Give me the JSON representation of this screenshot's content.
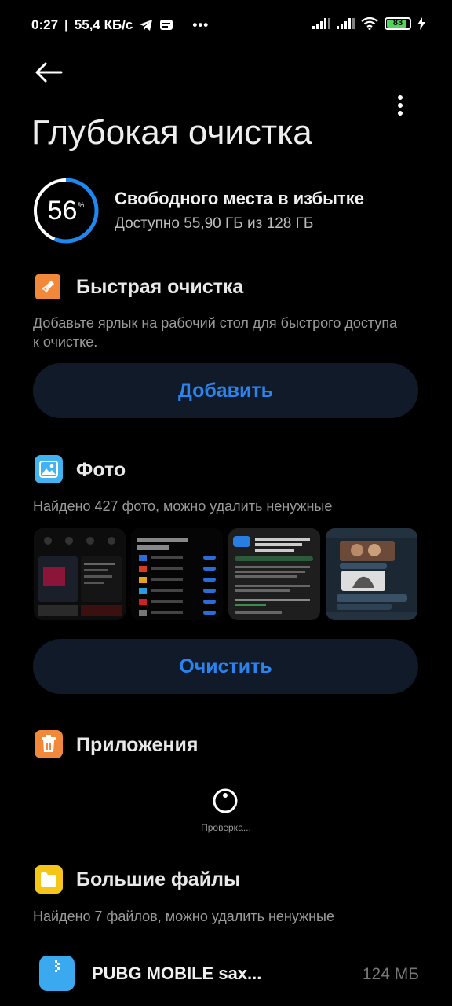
{
  "status_bar": {
    "time": "0:27",
    "speed": "55,4 КБ/с",
    "battery": "83",
    "overflow": "•••"
  },
  "page": {
    "title": "Глубокая очистка"
  },
  "storage": {
    "percent": "56",
    "percent_sign": "%",
    "percent_value": 56,
    "title": "Свободного места в избытке",
    "subtitle": "Доступно 55,90 ГБ из 128 ГБ"
  },
  "quick_clean": {
    "title": "Быстрая очистка",
    "description": "Добавьте ярлык на рабочий стол для быстрого доступа к очистке.",
    "button": "Добавить",
    "icon": "broom-icon"
  },
  "photos": {
    "title": "Фото",
    "description": "Найдено 427 фото, можно удалить ненужные",
    "button": "Очистить",
    "icon": "image-icon",
    "thumbnails": [
      "photo-thumbnail-1",
      "photo-thumbnail-2",
      "photo-thumbnail-3",
      "photo-thumbnail-4"
    ]
  },
  "apps": {
    "title": "Приложения",
    "loading": "Проверка...",
    "icon": "trash-icon"
  },
  "large_files": {
    "title": "Большие файлы",
    "description": "Найдено 7 файлов, можно удалить ненужные",
    "icon": "folder-icon",
    "files": [
      {
        "name": "PUBG MOBILE sax...",
        "size": "124 МБ"
      }
    ]
  },
  "colors": {
    "accent": "#2b83ee",
    "ring": "#1e88f0",
    "button_bg": "#101a28",
    "orange": "#f2893a",
    "photo_icon": "#40b3f0",
    "folder_icon": "#f5c518"
  }
}
